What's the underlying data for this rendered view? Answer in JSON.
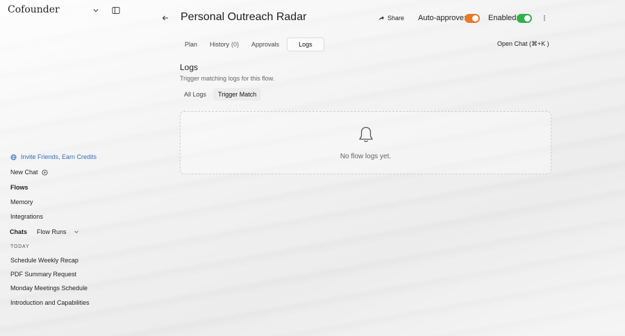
{
  "sidebar": {
    "brand": "Cofounder",
    "invite": "Invite Friends, Earn Credits",
    "new_chat": "New Chat",
    "flows": "Flows",
    "memory": "Memory",
    "integrations": "Integrations",
    "chats": "Chats",
    "flow_runs": "Flow Runs",
    "today": "TODAY",
    "chat_items": [
      "Schedule Weekly Recap",
      "PDF Summary Request",
      "Monday Meetings Schedule",
      "Introduction and Capabilities"
    ]
  },
  "header": {
    "title": "Personal Outreach Radar",
    "share": "Share",
    "auto_approve_label": "Auto-approve:",
    "enabled_label": "Enabled:",
    "auto_approve_on": true,
    "enabled_on": true
  },
  "tabs": {
    "plan": "Plan",
    "history": "History",
    "history_count": "(0)",
    "approvals": "Approvals",
    "logs": "Logs",
    "active": "Logs",
    "open_chat": "Open Chat (⌘+K )"
  },
  "logs": {
    "heading": "Logs",
    "subtitle": "Trigger matching logs for this flow.",
    "subtabs": [
      "All Logs",
      "Trigger Match"
    ],
    "active_subtab": "Trigger Match",
    "empty_text": "No flow logs yet."
  },
  "colors": {
    "accent_link": "#2f6fb8",
    "auto_approve_toggle": "#e8782a",
    "enabled_toggle": "#34b04a"
  },
  "icons": {
    "brand_dropdown": "chevron-down-icon",
    "sidebar_toggle": "sidebar-panel-icon",
    "invite": "globe-icon",
    "new_chat": "plus-circle-icon",
    "back": "arrow-left-icon",
    "share": "share-icon",
    "more": "more-vertical-icon",
    "empty": "bell-icon"
  }
}
